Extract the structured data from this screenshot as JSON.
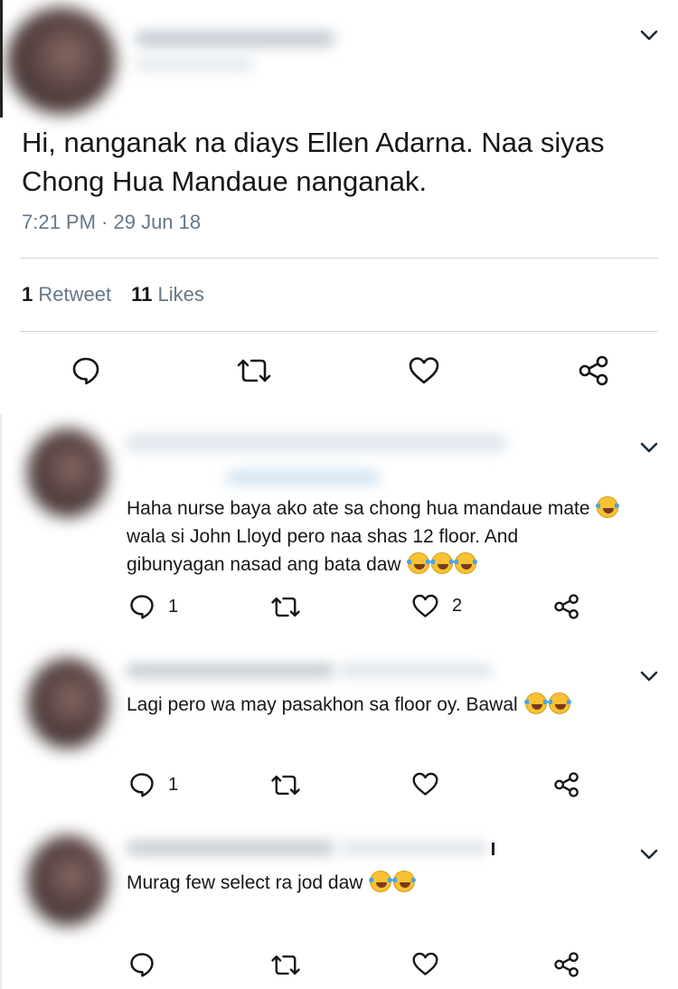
{
  "main_tweet": {
    "text": "Hi, nanganak na diays Ellen Adarna. Naa siyas Chong Hua Mandaue nanganak.",
    "timestamp": "7:21 PM · 29 Jun 18",
    "retweets_count": "1",
    "retweets_label": "Retweet",
    "likes_count": "11",
    "likes_label": "Likes"
  },
  "replies": [
    {
      "text": "Haha nurse baya ako ate sa chong hua mandaue mate",
      "text_line2": "wala si John Lloyd pero naa shas 12 floor. And",
      "text_line3": "gibunyagan nasad ang bata daw",
      "reply_count": "1",
      "like_count": "2"
    },
    {
      "text": "Lagi pero wa may pasakhon sa floor oy. Bawal",
      "reply_count": "1"
    },
    {
      "text": "Murag few select ra jod daw"
    }
  ],
  "icons": {
    "reply": "reply-icon",
    "retweet": "retweet-icon",
    "like": "heart-icon",
    "share": "share-icon",
    "more": "chevron-down-icon",
    "emoji": "face-with-tears-of-joy-emoji"
  },
  "colors": {
    "text": "#14171a",
    "secondary": "#657786",
    "divider": "#ccd6dd",
    "icon": "#14171a"
  }
}
